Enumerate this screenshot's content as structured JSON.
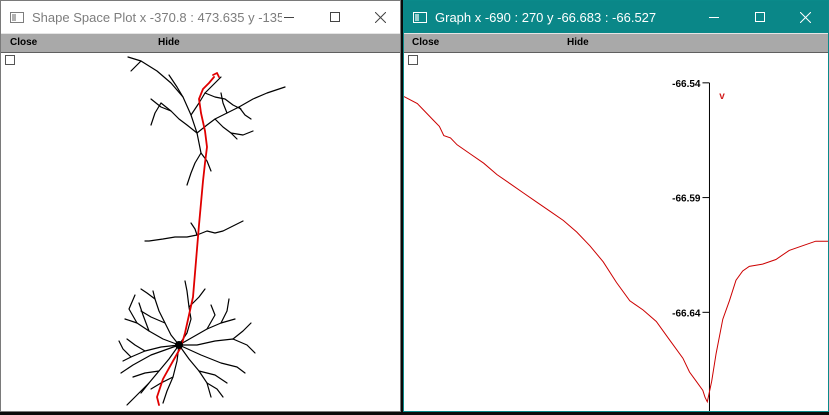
{
  "shape_window": {
    "title": "Shape Space Plot x -370.8 : 473.635  y -135....",
    "menu": {
      "close": "Close",
      "hide": "Hide"
    },
    "colors": {
      "dendrite": "#000000",
      "highlighted_path": "#e00000"
    }
  },
  "graph_window": {
    "title": "Graph  x -690 : 270  y -66.683 : -66.527",
    "menu": {
      "close": "Close",
      "hide": "Hide"
    },
    "marker_label": "v",
    "colors": {
      "trace": "#cc0000",
      "titlebar": "#0a8788"
    }
  },
  "chart_data": {
    "type": "line",
    "xlim": [
      -690,
      270
    ],
    "ylim": [
      -66.683,
      -66.527
    ],
    "yticks": [
      -66.54,
      -66.59,
      -66.64
    ],
    "ytick_labels": [
      "-66.54",
      "-66.59",
      "-66.64"
    ],
    "axis_x_position": 0,
    "series": [
      {
        "name": "v",
        "x": [
          -690,
          -660,
          -645,
          -625,
          -610,
          -600,
          -585,
          -570,
          -540,
          -510,
          -480,
          -450,
          -420,
          -390,
          -360,
          -330,
          -300,
          -270,
          -240,
          -210,
          -180,
          -150,
          -120,
          -90,
          -60,
          -45,
          -30,
          -15,
          -10,
          -5,
          5,
          15,
          30,
          45,
          60,
          75,
          90,
          120,
          150,
          180,
          210,
          240,
          270
        ],
        "y": [
          -66.546,
          -66.549,
          -66.552,
          -66.556,
          -66.559,
          -66.563,
          -66.564,
          -66.567,
          -66.571,
          -66.575,
          -66.58,
          -66.584,
          -66.588,
          -66.592,
          -66.596,
          -66.6,
          -66.605,
          -66.611,
          -66.618,
          -66.627,
          -66.635,
          -66.639,
          -66.644,
          -66.652,
          -66.66,
          -66.666,
          -66.67,
          -66.674,
          -66.677,
          -66.679,
          -66.67,
          -66.658,
          -66.643,
          -66.635,
          -66.626,
          -66.622,
          -66.62,
          -66.619,
          -66.617,
          -66.613,
          -66.611,
          -66.609,
          -66.609
        ]
      }
    ]
  }
}
